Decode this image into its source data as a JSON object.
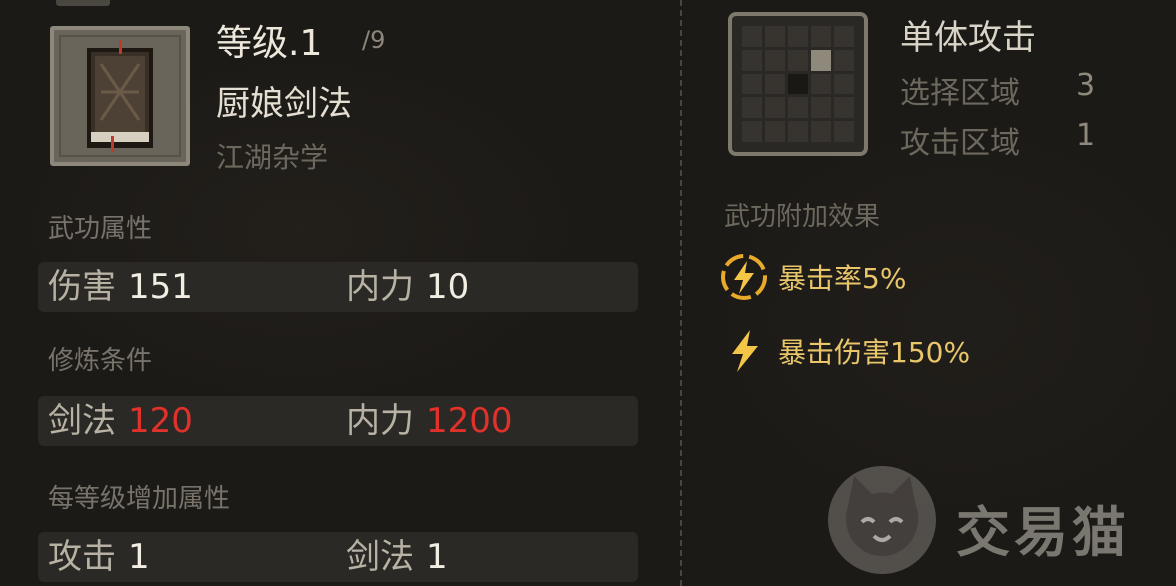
{
  "skill": {
    "level_label": "等级.1",
    "level_max": "/9",
    "name": "厨娘剑法",
    "category": "江湖杂学",
    "icon": "book-icon"
  },
  "attributes": {
    "label": "武功属性",
    "items": [
      {
        "key": "伤害",
        "value": "151"
      },
      {
        "key": "内力",
        "value": "10"
      }
    ]
  },
  "requirements": {
    "label": "修炼条件",
    "items": [
      {
        "key": "剑法",
        "value": "120"
      },
      {
        "key": "内力",
        "value": "1200"
      }
    ],
    "unmet_color": "#e0322a"
  },
  "per_level": {
    "label": "每等级增加属性",
    "items": [
      {
        "key": "攻击",
        "value": "1"
      },
      {
        "key": "剑法",
        "value": "1"
      }
    ]
  },
  "attack": {
    "type_label": "单体攻击",
    "select_label": "选择区域",
    "select_value": "3",
    "area_label": "攻击区域",
    "area_value": "1"
  },
  "effects": {
    "label": "武功附加效果",
    "items": [
      {
        "text": "暴击率5%",
        "icon": "lightning-ring-icon"
      },
      {
        "text": "暴击伤害150%",
        "icon": "lightning-icon"
      }
    ],
    "accent": "#e9c66a"
  },
  "watermark": {
    "text": "交易猫",
    "icon": "cat-logo-icon"
  }
}
